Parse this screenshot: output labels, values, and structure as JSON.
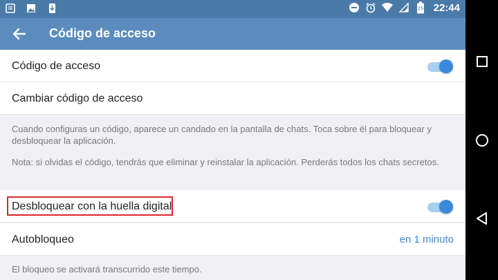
{
  "statusbar": {
    "time": "22:44",
    "left_icons": [
      "notes-icon",
      "image-icon",
      "phone-download-icon"
    ],
    "right_icons": [
      "do-not-disturb-icon",
      "alarm-icon",
      "wifi-icon",
      "signal-icon",
      "battery-icon"
    ]
  },
  "appbar": {
    "title": "Código de acceso"
  },
  "settings": {
    "passcode_label": "Código de acceso",
    "passcode_enabled": true,
    "change_passcode_label": "Cambiar código de acceso",
    "info_1": "Cuando configuras un código, aparece un candado en la pantalla de chats. Toca sobre él para bloquear y desbloquear la aplicación.",
    "info_2": "Nota: si olvidas el código, tendrás que eliminar y reinstalar la aplicación. Perderás todos los chats secretos.",
    "fingerprint_label": "Desbloquear con la huella digital",
    "fingerprint_enabled": true,
    "autolock_label": "Autobloqueo",
    "autolock_value": "en 1 minuto",
    "autolock_info": "El bloqueo se activará transcurrido este tiempo."
  },
  "colors": {
    "statusbar": "#4a7aa8",
    "appbar": "#5b8cbc",
    "accent": "#3b8ad9",
    "highlight": "#d8282c"
  }
}
